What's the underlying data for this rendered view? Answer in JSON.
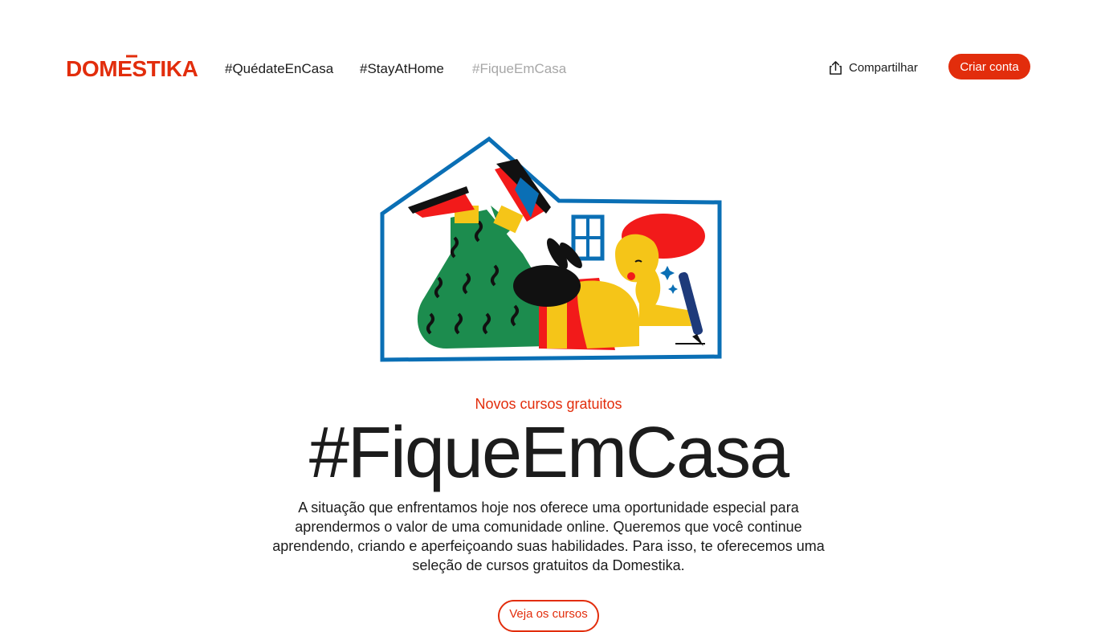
{
  "header": {
    "logo_text": "DOMESTIKA",
    "nav": [
      {
        "label": "#QuédateEnCasa",
        "active": false
      },
      {
        "label": "#StayAtHome",
        "active": false
      },
      {
        "label": "#FiqueEmCasa",
        "active": true
      }
    ],
    "share_label": "Compartilhar",
    "share_icon": "share-icon",
    "signup_label": "Criar conta"
  },
  "hero": {
    "eyebrow": "Novos cursos gratuitos",
    "title": "#FiqueEmCasa",
    "description": "A situação que enfrentamos hoje nos oferece uma oportunidade especial para aprendermos o valor de uma comunidade online. Queremos que você continue aprendendo, criando e aperfeiçoando suas habilidades. Para isso, te oferecemos uma seleção de cursos gratuitos da Domestika.",
    "cta_label": "Veja os cursos"
  },
  "colors": {
    "brand": "#e22d0c",
    "text": "#1c1c1c",
    "nav_active": "#a7a7a7",
    "illustration_blue": "#0a6fb5",
    "illustration_green": "#1c8c4e",
    "illustration_yellow": "#f5c518",
    "illustration_red": "#f21a1a"
  }
}
